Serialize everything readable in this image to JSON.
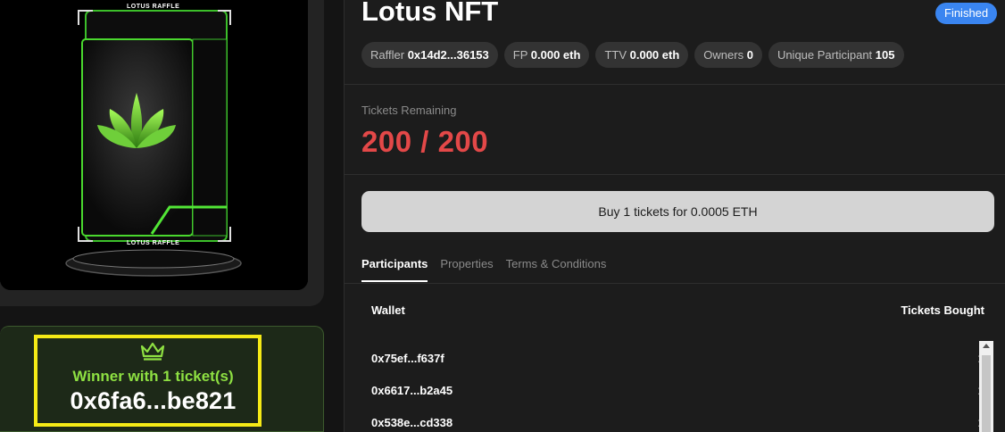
{
  "nft": {
    "title": "Lotus NFT",
    "status": "Finished",
    "image_top_text": "LOTUS RAFFLE",
    "image_bottom_text": "LOTUS RAFFLE"
  },
  "stats": [
    {
      "label": "Raffler",
      "value": "0x14d2...36153"
    },
    {
      "label": "FP",
      "value": "0.000 eth"
    },
    {
      "label": "TTV",
      "value": "0.000 eth"
    },
    {
      "label": "Owners",
      "value": "0"
    },
    {
      "label": "Unique Participant",
      "value": "105"
    }
  ],
  "tickets": {
    "label": "Tickets Remaining",
    "value": "200 / 200"
  },
  "buy_button_label": "Buy 1 tickets for 0.0005 ETH",
  "tabs": [
    {
      "label": "Participants",
      "active": true
    },
    {
      "label": "Properties",
      "active": false
    },
    {
      "label": "Terms & Conditions",
      "active": false
    }
  ],
  "table": {
    "headers": {
      "wallet": "Wallet",
      "tickets": "Tickets Bought"
    },
    "rows": [
      {
        "wallet": "0x75ef...f637f",
        "tickets": "1"
      },
      {
        "wallet": "0x6617...b2a45",
        "tickets": "1"
      },
      {
        "wallet": "0x538e...cd338",
        "tickets": "1"
      }
    ]
  },
  "winner": {
    "label": "Winner with 1 ticket(s)",
    "address": "0x6fa6...be821"
  },
  "colors": {
    "accent_green": "#8ee042",
    "status_blue": "#3a85f0",
    "tickets_red": "#e34848",
    "highlight_yellow": "#f5ea16"
  },
  "icons": {
    "winner": "crown-icon"
  }
}
